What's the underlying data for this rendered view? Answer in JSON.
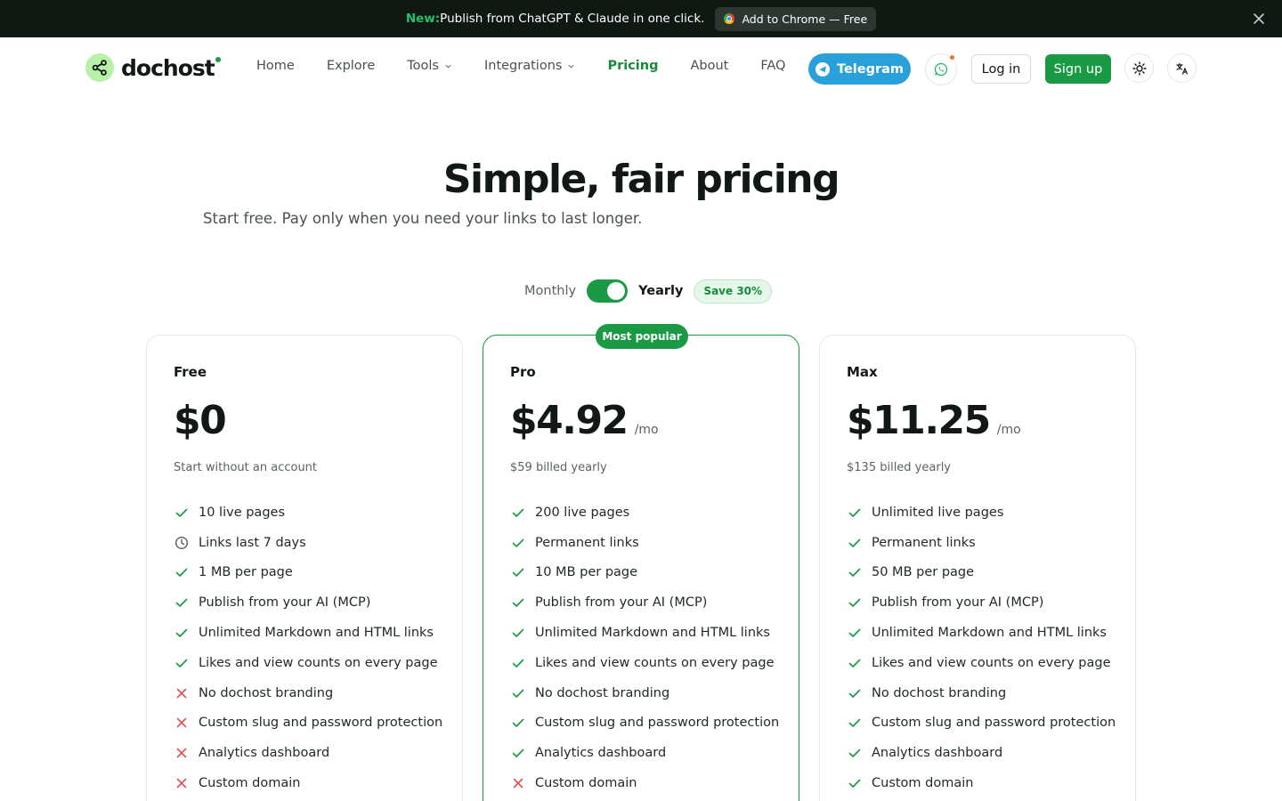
{
  "banner": {
    "new_label": "New:",
    "text": "Publish from ChatGPT & Claude in one click.",
    "chrome_button": "Add to Chrome — Free"
  },
  "header": {
    "logo_text": "dochost",
    "nav": [
      {
        "label": "Home"
      },
      {
        "label": "Explore"
      },
      {
        "label": "Tools"
      },
      {
        "label": "Integrations"
      },
      {
        "label": "Pricing"
      },
      {
        "label": "About"
      },
      {
        "label": "FAQ"
      }
    ],
    "telegram_label": "Telegram",
    "login_label": "Log in",
    "signup_label": "Sign up"
  },
  "hero": {
    "title": "Simple, fair pricing",
    "subtitle": "Start free. Pay only when you need your links to last longer."
  },
  "billing": {
    "monthly_label": "Monthly",
    "yearly_label": "Yearly",
    "selected": "Yearly",
    "save_badge": "Save 30%"
  },
  "colors": {
    "brand_green": "#1a9a44",
    "telegram_blue": "#2aa0da",
    "banner_bg": "#101814",
    "cross_red": "#d9534f"
  },
  "plans": [
    {
      "name": "Free",
      "price": "$0",
      "per": "",
      "billed": "Start without an account",
      "badge": "",
      "features": [
        {
          "text": "10 live pages",
          "icon": "check"
        },
        {
          "text": "Links last 7 days",
          "icon": "clock"
        },
        {
          "text": "1 MB per page",
          "icon": "check"
        },
        {
          "text": "Publish from your AI (MCP)",
          "icon": "check"
        },
        {
          "text": "Unlimited Markdown and HTML links",
          "icon": "check"
        },
        {
          "text": "Likes and view counts on every page",
          "icon": "check"
        },
        {
          "text": "No dochost branding",
          "icon": "cross"
        },
        {
          "text": "Custom slug and password protection",
          "icon": "cross"
        },
        {
          "text": "Analytics dashboard",
          "icon": "cross"
        },
        {
          "text": "Custom domain",
          "icon": "cross"
        }
      ]
    },
    {
      "name": "Pro",
      "price": "$4.92",
      "per": "/mo",
      "billed": "$59 billed yearly",
      "badge": "Most popular",
      "features": [
        {
          "text": "200 live pages",
          "icon": "check"
        },
        {
          "text": "Permanent links",
          "icon": "check"
        },
        {
          "text": "10 MB per page",
          "icon": "check"
        },
        {
          "text": "Publish from your AI (MCP)",
          "icon": "check"
        },
        {
          "text": "Unlimited Markdown and HTML links",
          "icon": "check"
        },
        {
          "text": "Likes and view counts on every page",
          "icon": "check"
        },
        {
          "text": "No dochost branding",
          "icon": "check"
        },
        {
          "text": "Custom slug and password protection",
          "icon": "check"
        },
        {
          "text": "Analytics dashboard",
          "icon": "check"
        },
        {
          "text": "Custom domain",
          "icon": "cross"
        }
      ]
    },
    {
      "name": "Max",
      "price": "$11.25",
      "per": "/mo",
      "billed": "$135 billed yearly",
      "badge": "",
      "features": [
        {
          "text": "Unlimited live pages",
          "icon": "check"
        },
        {
          "text": "Permanent links",
          "icon": "check"
        },
        {
          "text": "50 MB per page",
          "icon": "check"
        },
        {
          "text": "Publish from your AI (MCP)",
          "icon": "check"
        },
        {
          "text": "Unlimited Markdown and HTML links",
          "icon": "check"
        },
        {
          "text": "Likes and view counts on every page",
          "icon": "check"
        },
        {
          "text": "No dochost branding",
          "icon": "check"
        },
        {
          "text": "Custom slug and password protection",
          "icon": "check"
        },
        {
          "text": "Analytics dashboard",
          "icon": "check"
        },
        {
          "text": "Custom domain",
          "icon": "check"
        }
      ]
    }
  ]
}
